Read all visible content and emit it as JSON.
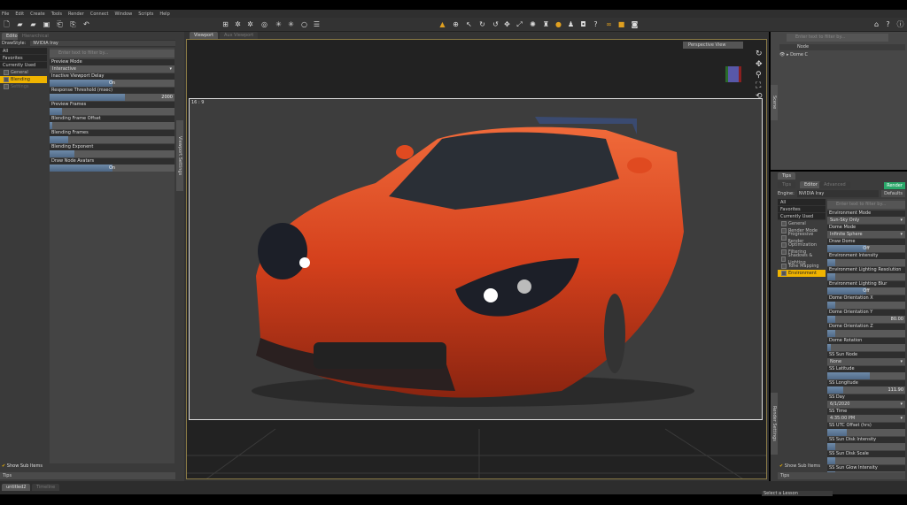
{
  "menu": [
    "File",
    "Edit",
    "Create",
    "Tools",
    "Render",
    "Connect",
    "Window",
    "Scripts",
    "Help"
  ],
  "left_panel": {
    "tabs": [
      "Editor",
      "Hierarchical"
    ],
    "drawstyle_label": "DrawStyle:",
    "drawstyle_value": "NVIDIA Iray",
    "filters": [
      "All",
      "Favorites",
      "Currently Used"
    ],
    "tree": [
      {
        "label": "General",
        "selected": false
      },
      {
        "label": "Blending",
        "selected": true
      },
      {
        "label": "Settings",
        "selected": false
      }
    ],
    "search_placeholder": "Enter text to filter by...",
    "properties": [
      {
        "label": "Preview Mode",
        "type": "select",
        "value": "Interactive"
      },
      {
        "label": "Inactive Viewport Delay",
        "type": "toggle",
        "value": "On"
      },
      {
        "label": "Response Threshold (msec)",
        "type": "slider",
        "value": "2000",
        "fill": 0.6
      },
      {
        "label": "Preview Frames",
        "type": "slider",
        "value": "",
        "fill": 0.1
      },
      {
        "label": "Blending Frame Offset",
        "type": "slider",
        "value": "",
        "fill": 0.02
      },
      {
        "label": "Blending Frames",
        "type": "slider",
        "value": "",
        "fill": 0.15
      },
      {
        "label": "Blending Exponent",
        "type": "slider",
        "value": "",
        "fill": 0.2
      },
      {
        "label": "Draw Node Avatars",
        "type": "toggle",
        "value": "On"
      }
    ],
    "side_tab": "Viewport Settings",
    "show_sub_items": "Show Sub Items",
    "tips_tab": "Tips"
  },
  "viewport": {
    "tabs": [
      "Viewport",
      "Aux Viewport"
    ],
    "view_select": "Perspective View",
    "frame_label": "16 : 9"
  },
  "scene": {
    "search_placeholder": "Enter text to filter by...",
    "column": "Node",
    "nodes": [
      "Dome C"
    ],
    "side_tab": "Scene"
  },
  "render_settings": {
    "tabs": [
      "Tips",
      "Editor",
      "Advanced"
    ],
    "top_tab": "Tips",
    "render_button": "Render",
    "engine_label": "Engine:",
    "engine_value": "NVIDIA Iray",
    "defaults": "Defaults",
    "filters": [
      "All",
      "Favorites",
      "Currently Used"
    ],
    "tree": [
      {
        "label": "General",
        "selected": false
      },
      {
        "label": "Render Mode",
        "selected": false
      },
      {
        "label": "Progressive Render",
        "selected": false
      },
      {
        "label": "Optimization",
        "selected": false
      },
      {
        "label": "Filtering",
        "selected": false
      },
      {
        "label": "Shadows & Lighting",
        "selected": false
      },
      {
        "label": "Tone Mapping",
        "selected": false
      },
      {
        "label": "Environment",
        "selected": true
      }
    ],
    "search_placeholder": "Enter text to filter by...",
    "properties": [
      {
        "label": "Environment Mode",
        "type": "select",
        "value": "Sun-Sky Only"
      },
      {
        "label": "Dome Mode",
        "type": "select",
        "value": "Infinite Sphere"
      },
      {
        "label": "Draw Dome",
        "type": "toggle",
        "value": "Off"
      },
      {
        "label": "Environment Intensity",
        "type": "slider",
        "value": "",
        "fill": 0.1
      },
      {
        "label": "Environment Lighting Resolution",
        "type": "slider",
        "value": "",
        "fill": 0.1
      },
      {
        "label": "Environment Lighting Blur",
        "type": "toggle",
        "value": "Off"
      },
      {
        "label": "Dome Orientation X",
        "type": "slider",
        "value": "",
        "fill": 0.1
      },
      {
        "label": "Dome Orientation Y",
        "type": "slider",
        "value": "80.00",
        "fill": 0.1
      },
      {
        "label": "Dome Orientation Z",
        "type": "slider",
        "value": "",
        "fill": 0.1
      },
      {
        "label": "Dome Rotation",
        "type": "slider",
        "value": "",
        "fill": 0.05
      },
      {
        "label": "SS Sun Node",
        "type": "select",
        "value": "None"
      },
      {
        "label": "SS Latitude",
        "type": "slider",
        "value": "",
        "fill": 0.55
      },
      {
        "label": "SS Longitude",
        "type": "slider",
        "value": "111.90",
        "fill": 0.2
      },
      {
        "label": "SS Day",
        "type": "select",
        "value": "6/1/2020"
      },
      {
        "label": "SS Time",
        "type": "select",
        "value": "4:35:00 PM"
      },
      {
        "label": "SS UTC Offset (hrs)",
        "type": "slider",
        "value": "",
        "fill": 0.25
      },
      {
        "label": "SS Sun Disk Intensity",
        "type": "slider",
        "value": "",
        "fill": 0.1
      },
      {
        "label": "SS Sun Disk Scale",
        "type": "slider",
        "value": "",
        "fill": 0.1
      },
      {
        "label": "SS Sun Glow Intensity",
        "type": "slider",
        "value": "",
        "fill": 0.1
      }
    ],
    "side_tab": "Render Settings",
    "show_sub_items": "Show Sub Items",
    "tips_tab": "Tips"
  },
  "bottom": {
    "tabs": [
      "untitled2",
      "Timeline"
    ],
    "lesson_select": "Select a Lesson"
  },
  "colors": {
    "accent": "#f0b400",
    "viewport_border": "#8a7a45",
    "car": "#d4401c"
  }
}
